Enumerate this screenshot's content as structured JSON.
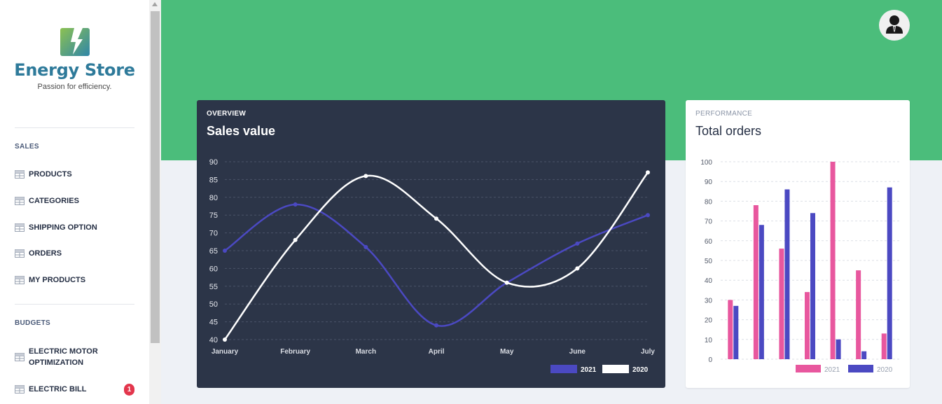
{
  "brand": {
    "name": "Energy Store",
    "tagline": "Passion for efficiency."
  },
  "sidebar": {
    "sections": [
      {
        "title": "SALES",
        "items": [
          {
            "label": "PRODUCTS"
          },
          {
            "label": "CATEGORIES"
          },
          {
            "label": "SHIPPING OPTION"
          },
          {
            "label": "ORDERS"
          },
          {
            "label": "MY PRODUCTS"
          }
        ]
      },
      {
        "title": "BUDGETS",
        "items": [
          {
            "label": "ELECTRIC MOTOR OPTIMIZATION"
          },
          {
            "label": "ELECTRIC BILL",
            "badge": "1"
          }
        ]
      }
    ]
  },
  "header": {
    "avatar_icon": "user-avatar-icon"
  },
  "colors": {
    "accent": "#4bbd7b",
    "dark_card": "#2c3548",
    "series_2021_line": "#4b49c2",
    "series_2021_bar": "#e8579e",
    "series_2020_bar": "#4b49c2",
    "badge": "#e3364c"
  },
  "cards": {
    "sales": {
      "kicker": "OVERVIEW",
      "title": "Sales value"
    },
    "orders": {
      "kicker": "PERFORMANCE",
      "title": "Total orders"
    }
  },
  "chart_data": [
    {
      "type": "line",
      "categories": [
        "January",
        "February",
        "March",
        "April",
        "May",
        "June",
        "July"
      ],
      "series": [
        {
          "name": "2021",
          "values": [
            65,
            78,
            66,
            44,
            56,
            67,
            75
          ]
        },
        {
          "name": "2020",
          "values": [
            40,
            68,
            86,
            74,
            56,
            60,
            87
          ]
        }
      ],
      "yticks": [
        40,
        45,
        50,
        55,
        60,
        65,
        70,
        75,
        80,
        85,
        90
      ],
      "ylim": [
        40,
        90
      ],
      "legend": "bottom-right",
      "grid": true
    },
    {
      "type": "bar",
      "categories": [
        "",
        "",
        "",
        "",
        "",
        "",
        ""
      ],
      "series": [
        {
          "name": "2021",
          "values": [
            30,
            78,
            56,
            34,
            100,
            45,
            13
          ]
        },
        {
          "name": "2020",
          "values": [
            27,
            68,
            86,
            74,
            10,
            4,
            87
          ]
        }
      ],
      "yticks": [
        0,
        10,
        20,
        30,
        40,
        50,
        60,
        70,
        80,
        90,
        100
      ],
      "ylim": [
        0,
        100
      ],
      "legend": "bottom-right",
      "grid": true
    }
  ]
}
